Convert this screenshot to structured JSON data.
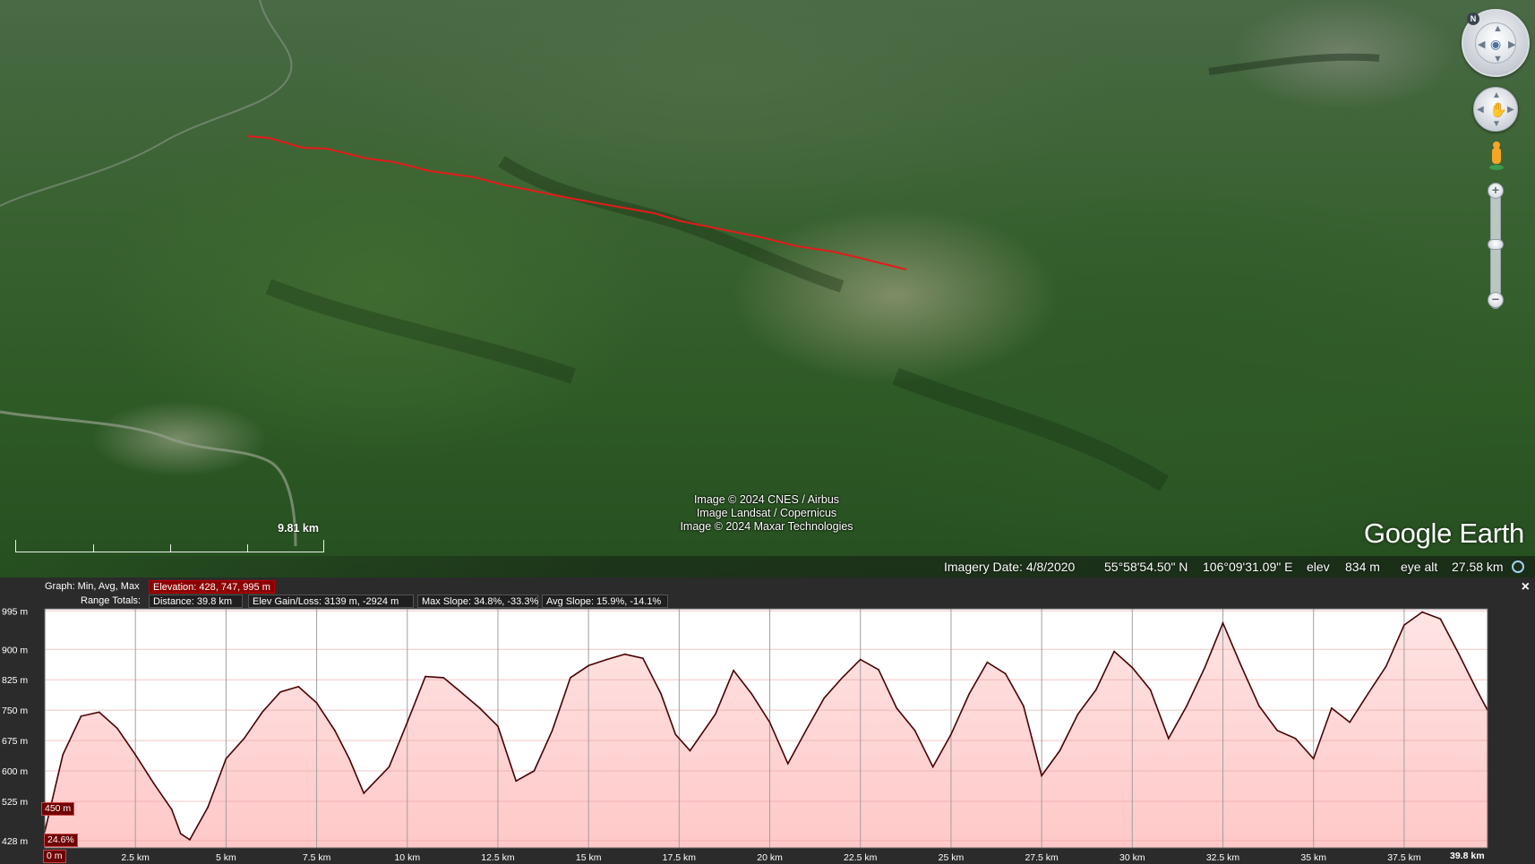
{
  "viewport": {
    "attribution": [
      "Image © 2024 CNES / Airbus",
      "Image Landsat / Copernicus",
      "Image © 2024 Maxar Technologies"
    ],
    "scale_label": "9.81 km",
    "logo": "Google Earth",
    "path_color": "#e31b1b",
    "status": {
      "imagery_date": "Imagery Date: 4/8/2020",
      "lat": "55°58'54.50\" N",
      "lon": "106°09'31.09\" E",
      "elev_label": "elev",
      "elev_value": "834 m",
      "eye_alt_label": "eye alt",
      "eye_alt_value": "27.58 km"
    },
    "controls": {
      "compass_letter": "N",
      "zoom_in": "+",
      "zoom_out": "−"
    }
  },
  "profile": {
    "close_label": "×",
    "graph_label": "Graph: Min, Avg, Max",
    "elevation_stats": "Elevation: 428, 747, 995 m",
    "range_totals_label": "Range Totals:",
    "distance": "Distance: 39.8 km",
    "elev_gain_loss": "Elev Gain/Loss: 3139 m, -2924 m",
    "max_slope": "Max Slope: 34.8%, -33.3%",
    "avg_slope": "Avg Slope: 15.9%, -14.1%",
    "marker_elev": "450 m",
    "marker_slope": "24.6%",
    "marker_dist": "0 m",
    "end_dist": "39.8 km",
    "line_color": "#4a0000",
    "fill_color": "#ffc8c8"
  },
  "chart_data": {
    "type": "area",
    "xlabel": "",
    "ylabel": "",
    "x_unit": "km",
    "y_unit": "m",
    "xlim": [
      0,
      39.8
    ],
    "ylim": [
      410,
      1000
    ],
    "y_ticks": [
      428,
      525,
      600,
      675,
      750,
      825,
      900,
      995
    ],
    "y_tick_labels": [
      "428 m",
      "525 m",
      "600 m",
      "675 m",
      "750 m",
      "825 m",
      "900 m",
      "995 m"
    ],
    "x_ticks": [
      2.5,
      5,
      7.5,
      10,
      12.5,
      15,
      17.5,
      20,
      22.5,
      25,
      27.5,
      30,
      32.5,
      35,
      37.5
    ],
    "x_tick_labels": [
      "2.5 km",
      "5 km",
      "7.5 km",
      "10 km",
      "12.5 km",
      "15 km",
      "17.5 km",
      "20 km",
      "22.5 km",
      "25 km",
      "27.5 km",
      "30 km",
      "32.5 km",
      "35 km",
      "37.5 km"
    ],
    "grid": true,
    "x": [
      0,
      0.5,
      1,
      1.5,
      2,
      2.5,
      3,
      3.5,
      3.75,
      4,
      4.5,
      5,
      5.5,
      6,
      6.5,
      7,
      7.5,
      8,
      8.4,
      8.8,
      9.5,
      10,
      10.5,
      11,
      11.5,
      12,
      12.5,
      13,
      13.5,
      14,
      14.5,
      15,
      15.5,
      16,
      16.5,
      17,
      17.4,
      17.8,
      18.5,
      19,
      19.5,
      20,
      20.5,
      21,
      21.5,
      22,
      22.5,
      23,
      23.5,
      24,
      24.5,
      25,
      25.5,
      26,
      26.5,
      27,
      27.5,
      28,
      28.5,
      29,
      29.5,
      30,
      30.5,
      31,
      31.5,
      32,
      32.5,
      33,
      33.5,
      34,
      34.5,
      35,
      35.5,
      36,
      36.5,
      37,
      37.5,
      38,
      38.5,
      39,
      39.5,
      39.8
    ],
    "y": [
      450,
      640,
      735,
      745,
      705,
      640,
      570,
      505,
      445,
      430,
      510,
      630,
      680,
      745,
      795,
      808,
      768,
      700,
      630,
      545,
      610,
      720,
      833,
      830,
      793,
      755,
      710,
      575,
      600,
      700,
      830,
      860,
      875,
      888,
      878,
      790,
      690,
      650,
      740,
      848,
      790,
      720,
      618,
      700,
      780,
      830,
      875,
      850,
      755,
      700,
      610,
      690,
      790,
      868,
      840,
      760,
      588,
      650,
      740,
      800,
      895,
      855,
      800,
      680,
      760,
      855,
      965,
      860,
      760,
      700,
      680,
      630,
      755,
      720,
      790,
      858,
      960,
      992,
      975,
      890,
      800,
      750,
      670
    ]
  }
}
